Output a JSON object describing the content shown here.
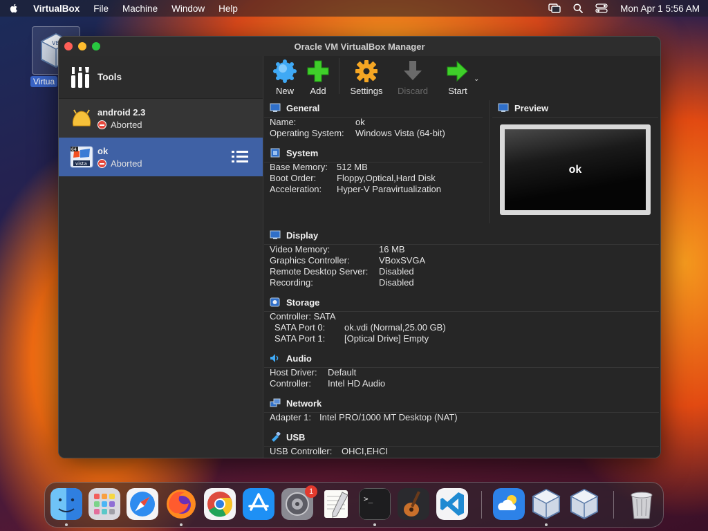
{
  "menubar": {
    "app_name": "VirtualBox",
    "items": [
      "File",
      "Machine",
      "Window",
      "Help"
    ],
    "clock": "Mon Apr 1  5:56 AM"
  },
  "desktop": {
    "icon_label": "Virtua"
  },
  "window": {
    "title": "Oracle VM VirtualBox Manager"
  },
  "sidebar": {
    "tools_label": "Tools",
    "vms": [
      {
        "name": "android 2.3",
        "state": "Aborted"
      },
      {
        "name": "ok",
        "state": "Aborted",
        "os_badge": "64",
        "os_label": "vista"
      }
    ]
  },
  "toolbar": {
    "new": "New",
    "add": "Add",
    "settings": "Settings",
    "discard": "Discard",
    "start": "Start"
  },
  "details": {
    "general": {
      "title": "General",
      "rows": [
        {
          "k": "Name:",
          "v": "ok"
        },
        {
          "k": "Operating System:",
          "v": "Windows Vista (64-bit)"
        }
      ]
    },
    "system": {
      "title": "System",
      "rows": [
        {
          "k": "Base Memory:",
          "v": "512 MB"
        },
        {
          "k": "Boot Order:",
          "v": "Floppy,Optical,Hard Disk"
        },
        {
          "k": "Acceleration:",
          "v": "Hyper-V Paravirtualization"
        }
      ]
    },
    "preview": {
      "title": "Preview",
      "screen_text": "ok"
    },
    "display": {
      "title": "Display",
      "rows": [
        {
          "k": "Video Memory:",
          "v": "16 MB"
        },
        {
          "k": "Graphics Controller:",
          "v": "VBoxSVGA"
        },
        {
          "k": "Remote Desktop Server:",
          "v": "Disabled"
        },
        {
          "k": "Recording:",
          "v": "Disabled"
        }
      ]
    },
    "storage": {
      "title": "Storage",
      "controller": "Controller: SATA",
      "rows": [
        {
          "k": "SATA Port 0:",
          "v": "ok.vdi (Normal,25.00 GB)"
        },
        {
          "k": "SATA Port 1:",
          "v": "[Optical Drive] Empty"
        }
      ]
    },
    "audio": {
      "title": "Audio",
      "rows": [
        {
          "k": "Host Driver:",
          "v": "Default"
        },
        {
          "k": "Controller:",
          "v": "Intel HD Audio"
        }
      ]
    },
    "network": {
      "title": "Network",
      "rows": [
        {
          "k": "Adapter 1:",
          "v": "Intel PRO/1000 MT Desktop (NAT)"
        }
      ]
    },
    "usb": {
      "title": "USB",
      "rows": [
        {
          "k": "USB Controller:",
          "v": "OHCI,EHCI"
        }
      ]
    }
  },
  "dock": {
    "apps": [
      "Finder",
      "Launchpad",
      "Safari",
      "Firefox",
      "Chrome",
      "App Store",
      "System Settings",
      "TextEdit",
      "Terminal",
      "GarageBand",
      "Visual Studio Code",
      "Weather",
      "VirtualBox",
      "VirtualBox"
    ],
    "settings_badge": "1"
  },
  "colors": {
    "selection": "#3f61a5",
    "window_bg": "#262626",
    "sidebar_bg": "#2c2c2c"
  }
}
